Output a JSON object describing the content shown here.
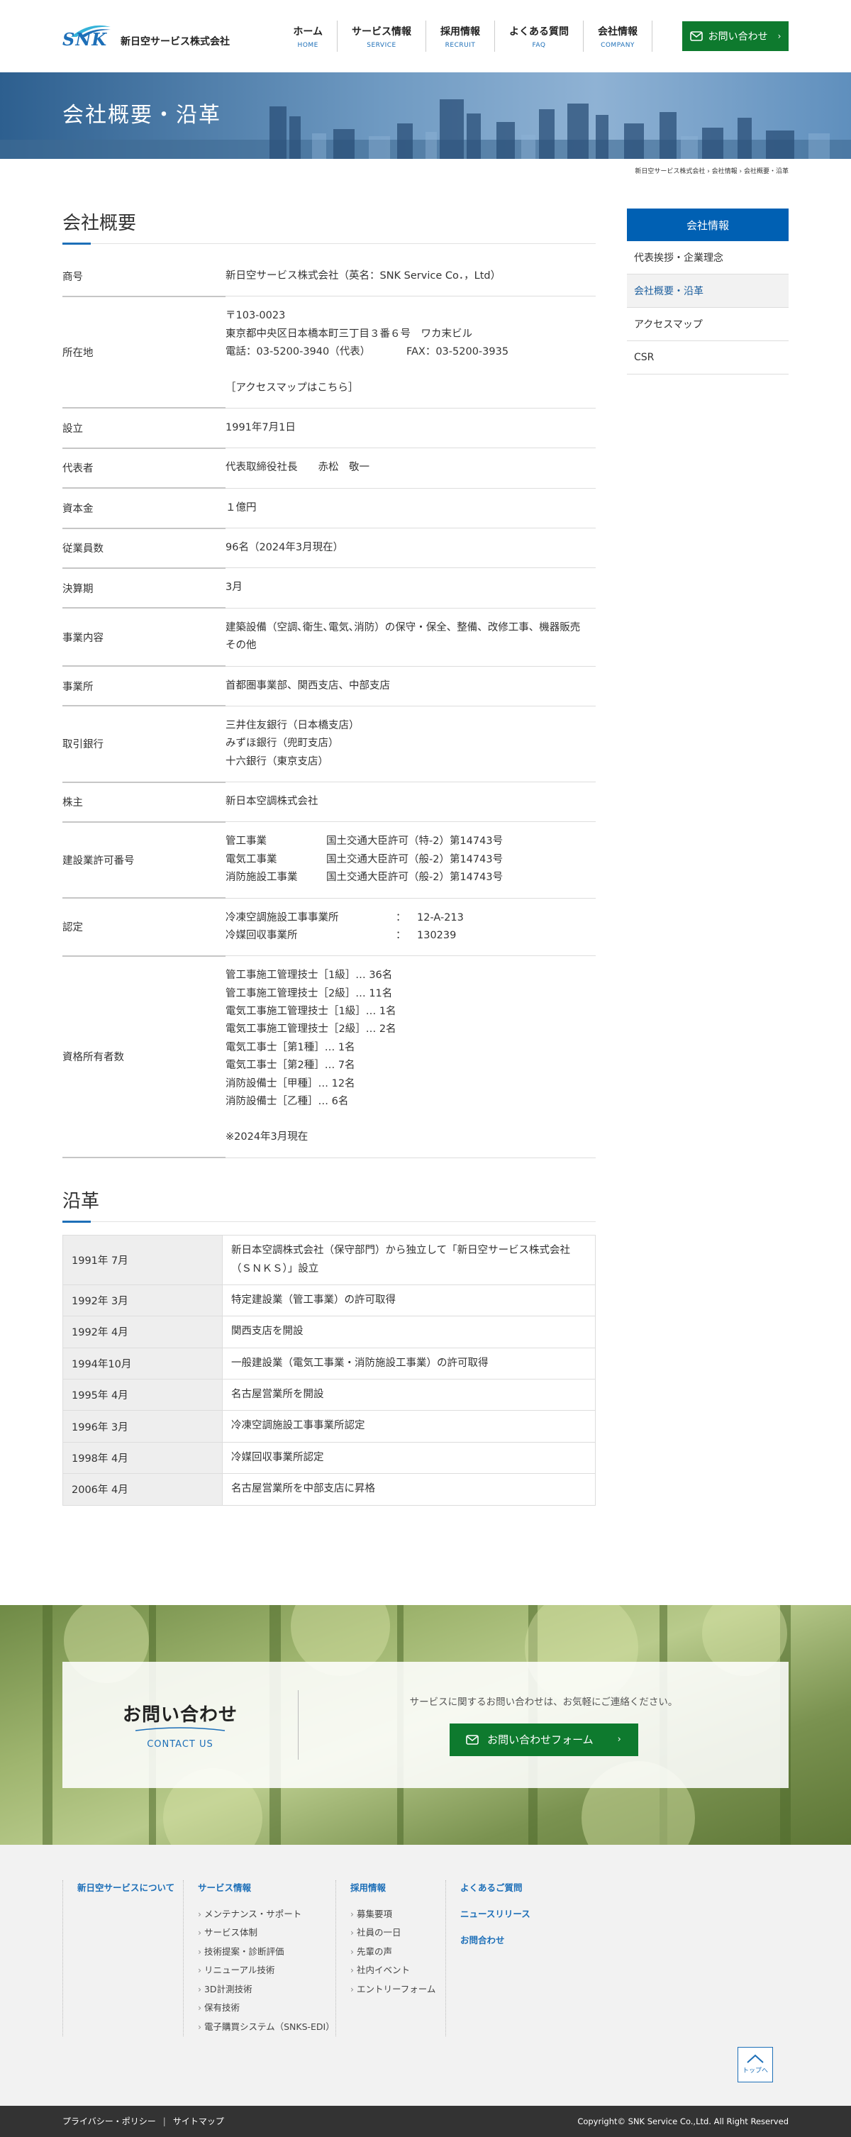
{
  "header": {
    "logo_text": "SNK",
    "company_name": "新日空サービス株式会社",
    "nav": [
      {
        "jp": "ホーム",
        "en": "HOME"
      },
      {
        "jp": "サービス情報",
        "en": "SERVICE"
      },
      {
        "jp": "採用情報",
        "en": "RECRUIT"
      },
      {
        "jp": "よくある質問",
        "en": "FAQ"
      },
      {
        "jp": "会社情報",
        "en": "COMPANY"
      }
    ],
    "contact_label": "お問い合わせ"
  },
  "hero": {
    "title": "会社概要・沿革"
  },
  "breadcrumb": "新日空サービス株式会社 › 会社情報 › 会社概要・沿革",
  "profile": {
    "title": "会社概要",
    "rows": [
      {
        "label": "商号",
        "value": "新日空サービス株式会社（英名：SNK Service Co．，Ltd）"
      },
      {
        "label": "所在地",
        "postal": "〒103-0023",
        "address": "東京都中央区日本橋本町三丁目３番６号　ワカ末ビル",
        "tel": "電話：03-5200-3940（代表）",
        "fax": "FAX：03-5200-3935",
        "map_link": "［アクセスマップはこちら］"
      },
      {
        "label": "設立",
        "value": "1991年7月1日"
      },
      {
        "label": "代表者",
        "value": "代表取締役社長　　赤松　敬一"
      },
      {
        "label": "資本金",
        "value": "１億円"
      },
      {
        "label": "従業員数",
        "value": "96名（2024年3月現在）"
      },
      {
        "label": "決算期",
        "value": "3月"
      },
      {
        "label": "事業内容",
        "value": "建築設備（空調､衛生､電気､消防）の保守・保全、整備、改修工事、機器販売　その他"
      },
      {
        "label": "事業所",
        "value": "首都圏事業部、関西支店、中部支店"
      },
      {
        "label": "取引銀行",
        "lines": [
          "三井住友銀行（日本橋支店）",
          "みずほ銀行（兜町支店）",
          "十六銀行（東京支店）"
        ]
      },
      {
        "label": "株主",
        "value": "新日本空調株式会社"
      },
      {
        "label": "建設業許可番号",
        "items": [
          {
            "k": "管工事業",
            "v": "国土交通大臣許可（特-2）第14743号"
          },
          {
            "k": "電気工事業",
            "v": "国土交通大臣許可（般-2）第14743号"
          },
          {
            "k": "消防施設工事業",
            "v": "国土交通大臣許可（般-2）第14743号"
          }
        ]
      },
      {
        "label": "認定",
        "items": [
          {
            "k": "冷凍空調施設工事事業所",
            "c": "：",
            "v": "12-A-213"
          },
          {
            "k": "冷媒回収事業所",
            "c": "：",
            "v": "130239"
          }
        ]
      },
      {
        "label": "資格所有者数",
        "lines": [
          "管工事施工管理技士［1級］… 36名",
          "管工事施工管理技士［2級］… 11名",
          "電気工事施工管理技士［1級］… 1名",
          "電気工事施工管理技士［2級］… 2名",
          "電気工事士［第1種］… 1名",
          "電気工事士［第2種］… 7名",
          "消防設備士［甲種］… 12名",
          "消防設備士［乙種］… 6名"
        ],
        "note": "※2024年3月現在"
      }
    ]
  },
  "history": {
    "title": "沿革",
    "rows": [
      {
        "date": "1991年 7月",
        "event": "新日本空調株式会社（保守部門）から独立して「新日空サービス株式会社（ＳＮＫＳ）」設立"
      },
      {
        "date": "1992年 3月",
        "event": "特定建設業（管工事業）の許可取得"
      },
      {
        "date": "1992年 4月",
        "event": "関西支店を開設"
      },
      {
        "date": "1994年10月",
        "event": "一般建設業（電気工事業・消防施設工事業）の許可取得"
      },
      {
        "date": "1995年 4月",
        "event": "名古屋営業所を開設"
      },
      {
        "date": "1996年 3月",
        "event": "冷凍空調施設工事事業所認定"
      },
      {
        "date": "1998年 4月",
        "event": "冷媒回収事業所認定"
      },
      {
        "date": "2006年 4月",
        "event": "名古屋営業所を中部支店に昇格"
      }
    ]
  },
  "sidebar": {
    "title": "会社情報",
    "items": [
      "代表挨拶・企業理念",
      "会社概要・沿革",
      "アクセスマップ",
      "CSR"
    ]
  },
  "contact": {
    "title_jp": "お問い合わせ",
    "title_en": "CONTACT US",
    "lead": "サービスに関するお問い合わせは、お気軽にご連絡ください。",
    "button": "お問い合わせフォーム"
  },
  "footer": {
    "col1_heading": "新日空サービスについて",
    "col2_heading": "サービス情報",
    "col2_items": [
      "メンテナンス・サポート",
      "サービス体制",
      "技術提案・診断評価",
      "リニューアル技術",
      "3D計測技術",
      "保有技術",
      "電子購買システム（SNKS-EDI）"
    ],
    "col3_heading": "採用情報",
    "col3_items": [
      "募集要項",
      "社員の一日",
      "先輩の声",
      "社内イベント",
      "エントリーフォーム"
    ],
    "col4_headings": [
      "よくあるご質問",
      "ニュースリリース",
      "お問合わせ"
    ],
    "pagetop": "トップへ",
    "privacy": "プライバシー・ポリシー",
    "separator": "|",
    "sitemap": "サイトマップ",
    "copyright": "Copyright© SNK Service Co.,Ltd. All Right Reserved"
  },
  "colors": {
    "brand_blue": "#1d6fb8",
    "sidebar_blue": "#0060b3",
    "cta_green": "#0e7a2e",
    "footer_bar": "#333333"
  }
}
